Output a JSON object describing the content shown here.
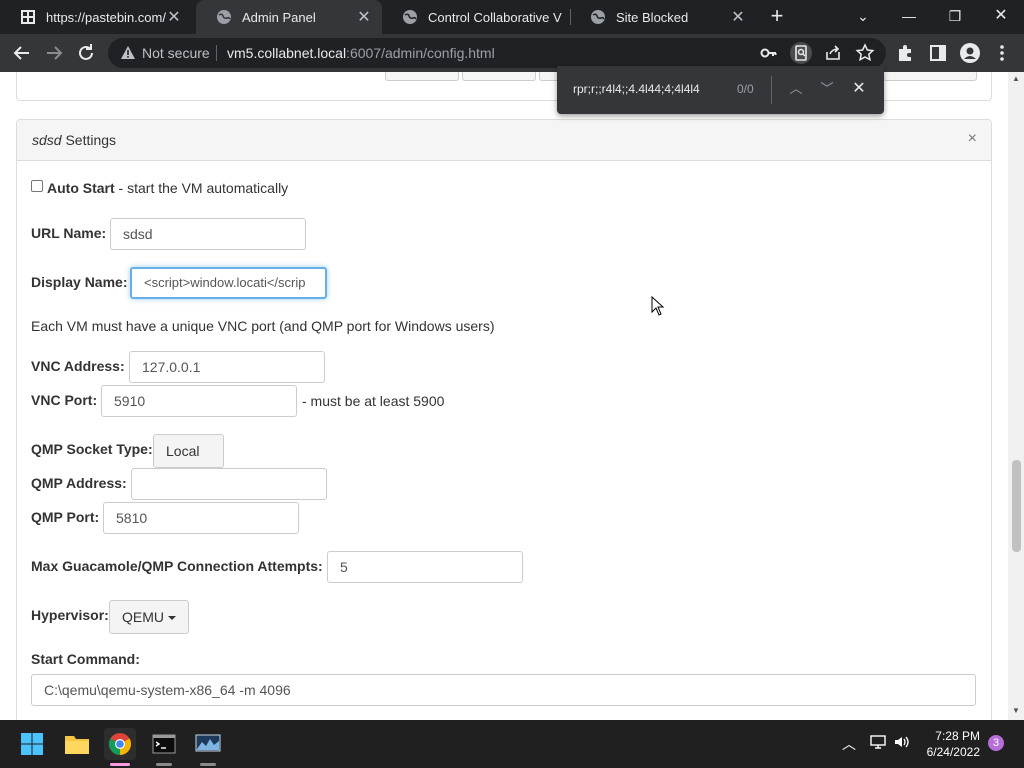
{
  "browser": {
    "tabs": [
      {
        "title": "https://pastebin.com/r",
        "active": false
      },
      {
        "title": "Admin Panel",
        "active": true
      },
      {
        "title": "Control Collaborative V",
        "active": false
      },
      {
        "title": "Site Blocked",
        "active": false
      }
    ],
    "new_tab_label": "+",
    "security_label": "Not secure",
    "url_host": "vm5.collabnet.local",
    "url_rest": ":6007/admin/config.html"
  },
  "find_bar": {
    "query": "rpr;r;;r4l4;;4.4l44;4;4l4l4",
    "count": "0/0"
  },
  "panel": {
    "title_italic": "sdsd",
    "title_rest": " Settings",
    "close_glyph": "×"
  },
  "form": {
    "auto_start": {
      "label": "Auto Start",
      "desc": " - start the VM automatically",
      "checked": false
    },
    "url_name": {
      "label": "URL Name:",
      "value": "sdsd"
    },
    "display_name": {
      "label": "Display Name:",
      "value": "<script>window.locati</scrip"
    },
    "vnc_note": "Each VM must have a unique VNC port (and QMP port for Windows users)",
    "vnc_address": {
      "label": "VNC Address:",
      "value": "127.0.0.1"
    },
    "vnc_port": {
      "label": "VNC Port:",
      "value": "5910",
      "hint": "- must be at least 5900"
    },
    "qmp_socket_type": {
      "label": "QMP Socket Type:",
      "value": "Local"
    },
    "qmp_address": {
      "label": "QMP Address:",
      "value": ""
    },
    "qmp_port": {
      "label": "QMP Port:",
      "value": "5810"
    },
    "max_attempts": {
      "label": "Max Guacamole/QMP Connection Attempts:",
      "value": "5"
    },
    "hypervisor": {
      "label": "Hypervisor:",
      "value": "QEMU"
    },
    "start_command": {
      "label": "Start Command:",
      "value": "C:\\qemu\\qemu-system-x86_64 -m 4096"
    }
  },
  "taskbar": {
    "time": "7:28 PM",
    "date": "6/24/2022",
    "notification_count": "3"
  },
  "icons": [
    "pastebin-icon",
    "globe-icon",
    "back-icon",
    "forward-icon",
    "reload-icon",
    "warning-icon",
    "key-icon",
    "find-icon",
    "share-icon",
    "star-icon",
    "extensions-icon",
    "sidebar-icon",
    "profile-icon",
    "menu-icon",
    "windows-start-icon",
    "folder-icon",
    "chrome-icon",
    "terminal-icon",
    "monitor-icon",
    "chevron-up-icon",
    "network-icon",
    "volume-icon"
  ],
  "colors": {
    "tab_bar": "#202124",
    "toolbar": "#35363a",
    "focus": "#66afe9",
    "taskbar": "#202020"
  }
}
